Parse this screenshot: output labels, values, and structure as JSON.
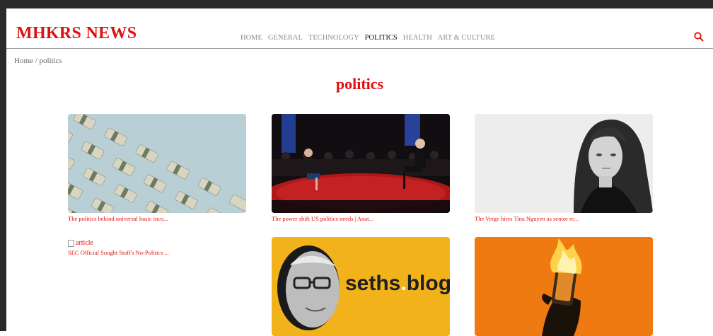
{
  "site": {
    "logo": "MHKRS NEWS",
    "accent_color": "#e01010"
  },
  "nav": {
    "items": [
      "HOME",
      "GENERAL",
      "TECHNOLOGY",
      "POLITICS",
      "HEALTH",
      "ART & CULTURE"
    ],
    "active": "POLITICS"
  },
  "header": {
    "search_icon": "search-icon"
  },
  "breadcrumb": {
    "home": "Home",
    "separator": " / ",
    "current": "politics"
  },
  "page": {
    "title": "politics"
  },
  "articles": [
    {
      "caption": "The politics behind universal basic inco...",
      "image": "money-stacks"
    },
    {
      "caption": "The power shift US politics needs | Anat...",
      "image": "stage-conversation"
    },
    {
      "caption": "The Verge hires Tina Nguyen as senior re...",
      "image": "portrait"
    },
    {
      "caption": "SEC Official Sought Staff's No-Politics ...",
      "image_alt": "article"
    },
    {
      "caption": "",
      "image": "seths-blog",
      "logo_text_1": "seths",
      "logo_dot": ".",
      "logo_text_2": "blog"
    },
    {
      "caption": "",
      "image": "burning-phone"
    }
  ]
}
